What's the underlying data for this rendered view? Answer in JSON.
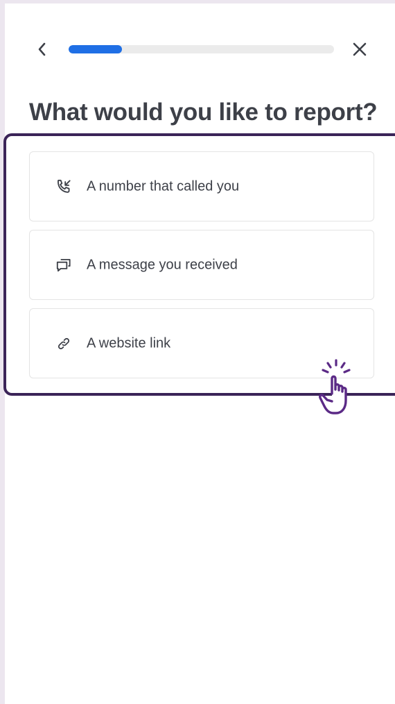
{
  "header": {
    "progress": 0.2,
    "back_icon": "chevron-left-icon",
    "close_icon": "close-icon"
  },
  "title": "What would you like to report?",
  "options": [
    {
      "label": "A number that called you",
      "icon": "incoming-call-icon"
    },
    {
      "label": "A message you received",
      "icon": "message-icon"
    },
    {
      "label": "A website link",
      "icon": "link-icon"
    }
  ],
  "colors": {
    "progress_fill": "#1f6fe5",
    "progress_track": "#ebebeb",
    "highlight": "#3b2458",
    "pointer": "#5b2a86",
    "text": "#3d4048"
  },
  "annotation": {
    "pointer_icon": "tap-hand-icon"
  }
}
